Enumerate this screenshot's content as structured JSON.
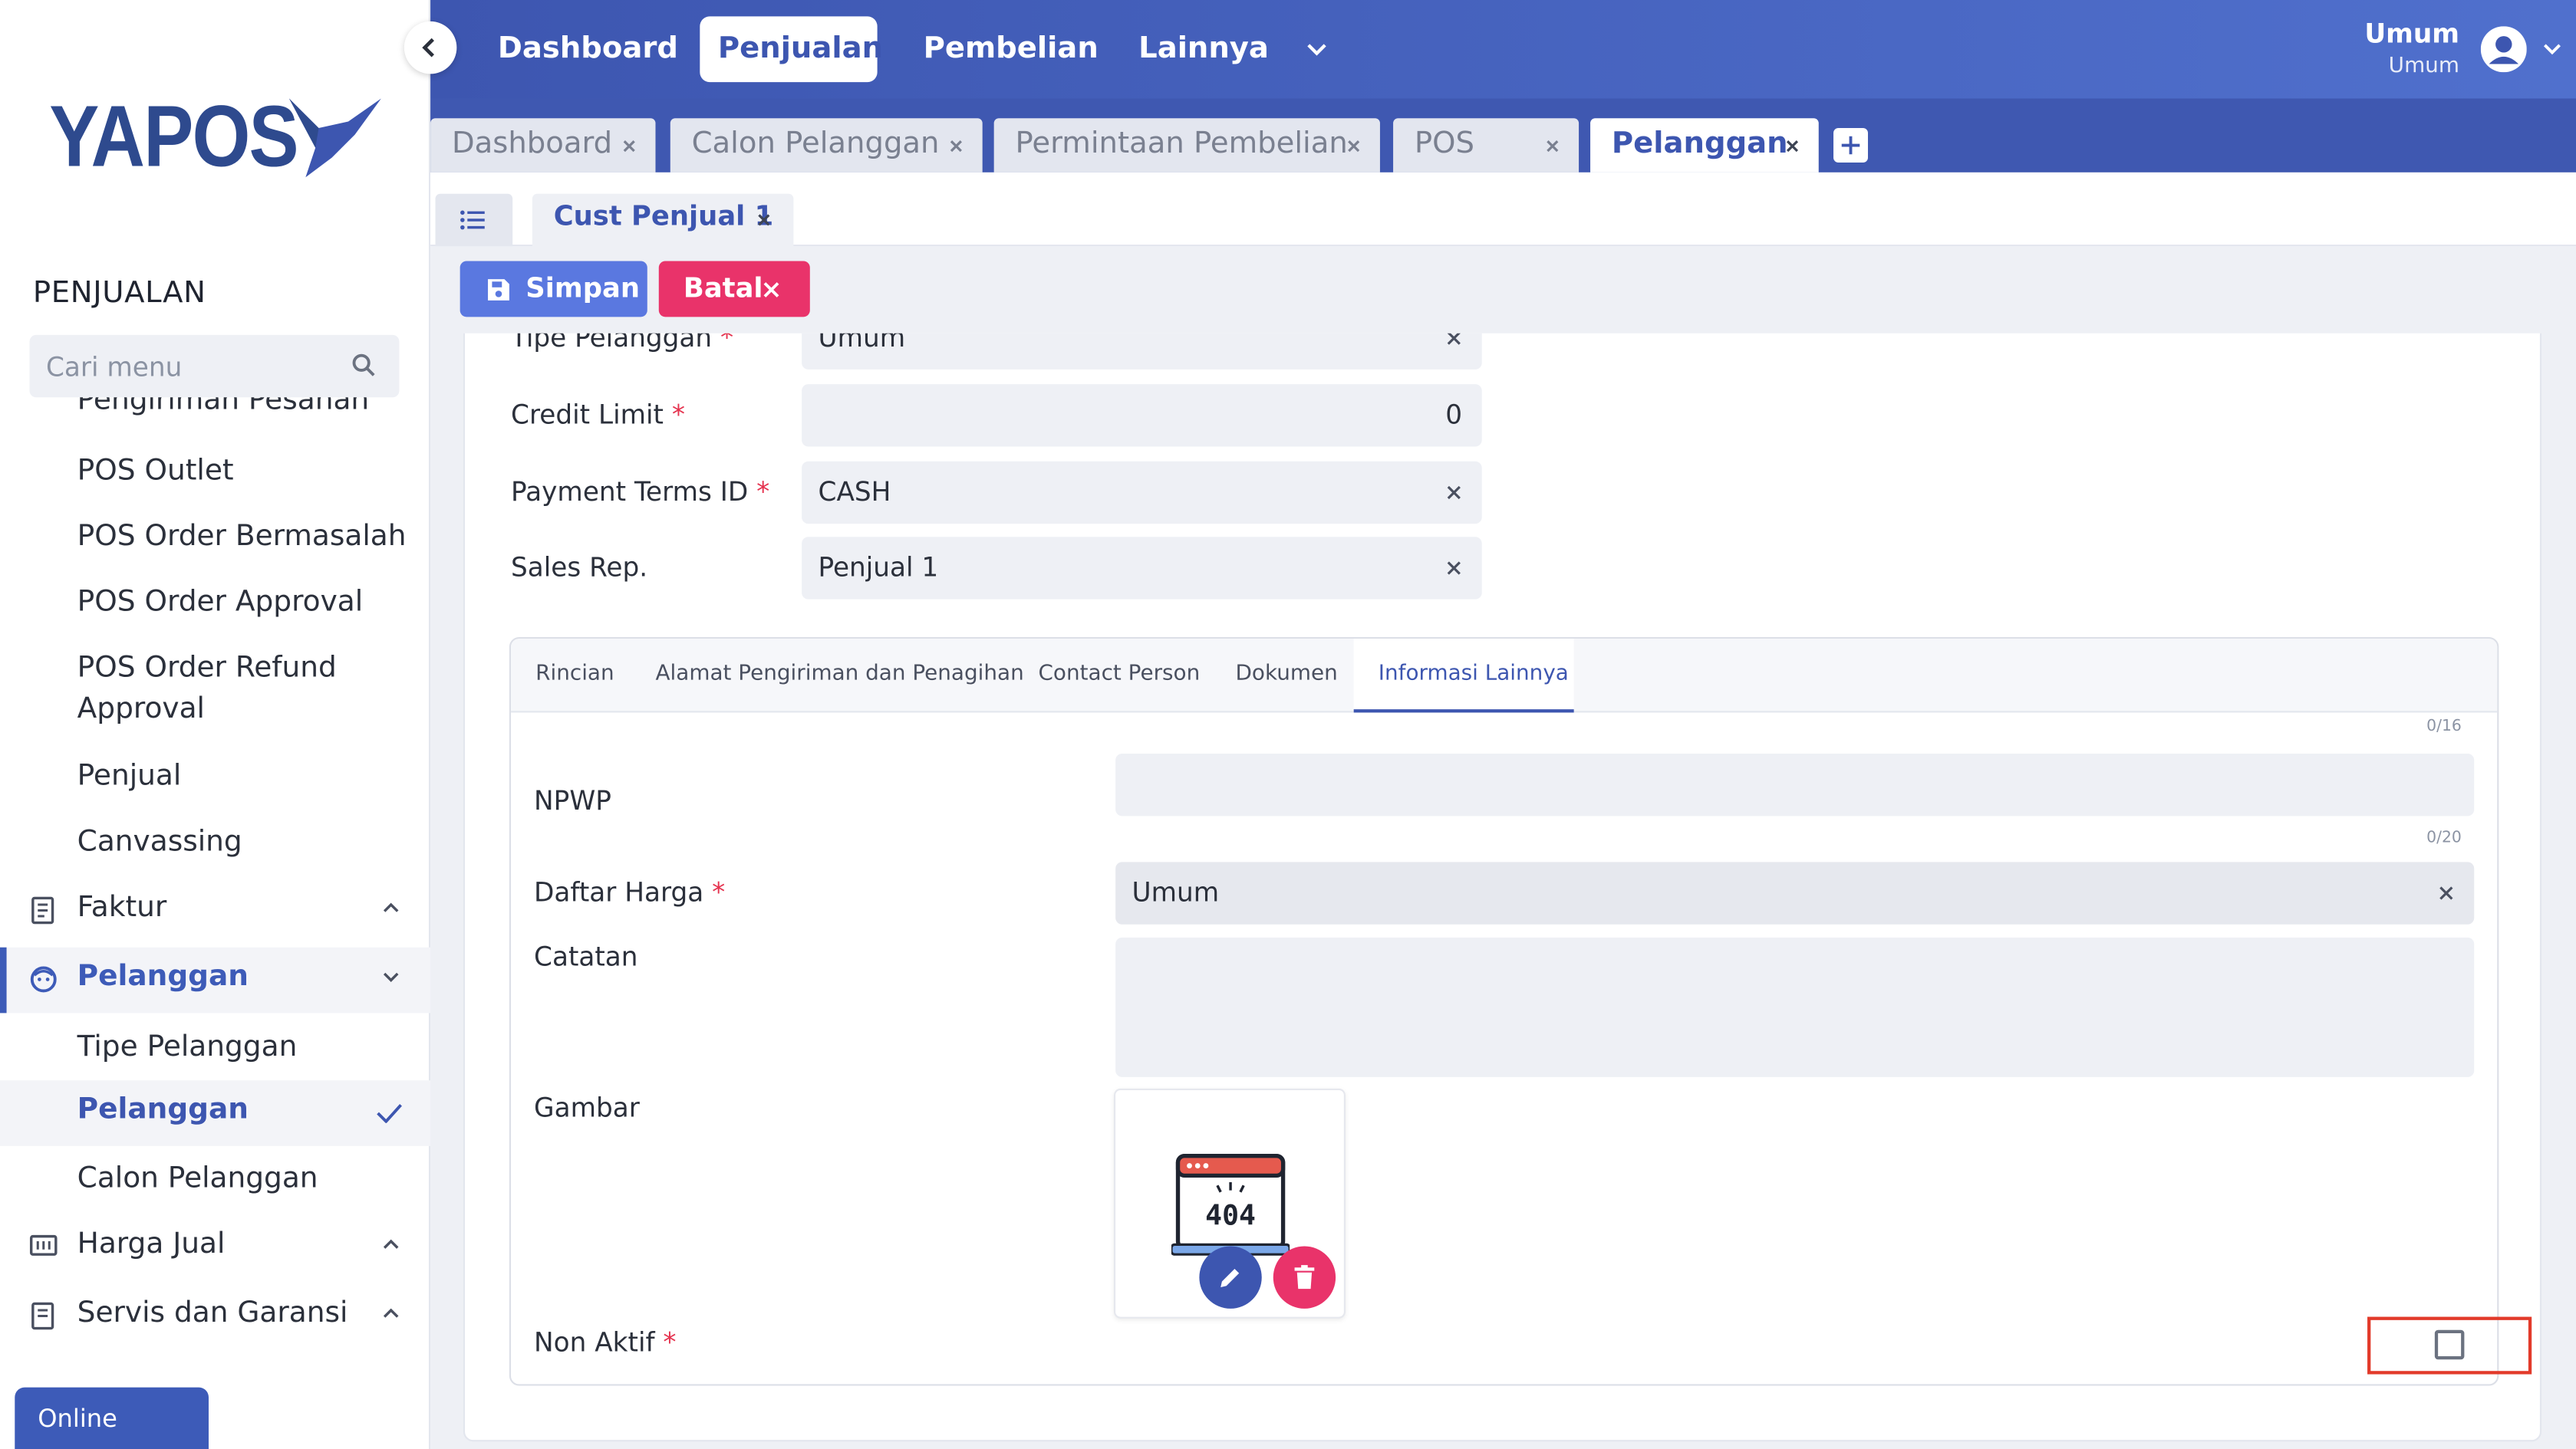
{
  "app": {
    "logo_text": "YAPOS"
  },
  "sidebar": {
    "section_title": "PENJUALAN",
    "search_placeholder": "Cari menu",
    "partial_item": "Pengiriman Pesanan",
    "items": [
      "POS Outlet",
      "POS Order Bermasalah",
      "POS Order Approval",
      "POS Order Refund",
      "Approval",
      "Penjual",
      "Canvassing"
    ],
    "groups": {
      "faktur": "Faktur",
      "pelanggan": "Pelanggan",
      "harga_jual": "Harga Jual",
      "servis": "Servis dan Garansi"
    },
    "pelanggan_sub": [
      "Tipe Pelanggan",
      "Pelanggan",
      "Calon Pelanggan"
    ],
    "online_label": "Online"
  },
  "topnav": {
    "items": [
      "Dashboard",
      "Penjualan",
      "Pembelian",
      "Lainnya"
    ],
    "active": "Penjualan",
    "user_name": "Umum",
    "user_role": "Umum"
  },
  "page_tabs": [
    "Dashboard",
    "Calon Pelanggan",
    "Permintaan Pembelian",
    "POS",
    "Pelanggan"
  ],
  "active_page_tab": "Pelanggan",
  "subtab": {
    "label": "Cust Penjual 1"
  },
  "actions": {
    "save": "Simpan",
    "cancel": "Batal"
  },
  "form": {
    "tipe_pelanggan": {
      "label": "Tipe Pelanggan",
      "value": "Umum"
    },
    "credit_limit": {
      "label": "Credit Limit",
      "value": "0"
    },
    "payment_terms": {
      "label": "Payment Terms ID",
      "value": "CASH"
    },
    "sales_rep": {
      "label": "Sales Rep.",
      "value": "Penjual 1"
    }
  },
  "inner_tabs": [
    "Rincian",
    "Alamat Pengiriman dan Penagihan",
    "Contact Person",
    "Dokumen",
    "Informasi Lainnya"
  ],
  "active_inner_tab": "Informasi Lainnya",
  "info": {
    "counter_top": "0/16",
    "npwp": {
      "label": "NPWP",
      "value": "",
      "counter": "0/20"
    },
    "daftar_harga": {
      "label": "Daftar Harga",
      "value": "Umum"
    },
    "catatan": {
      "label": "Catatan",
      "value": ""
    },
    "gambar": {
      "label": "Gambar",
      "placeholder_text": "404"
    },
    "non_aktif": {
      "label": "Non Aktif",
      "checked": false
    }
  },
  "required_mark": "*"
}
